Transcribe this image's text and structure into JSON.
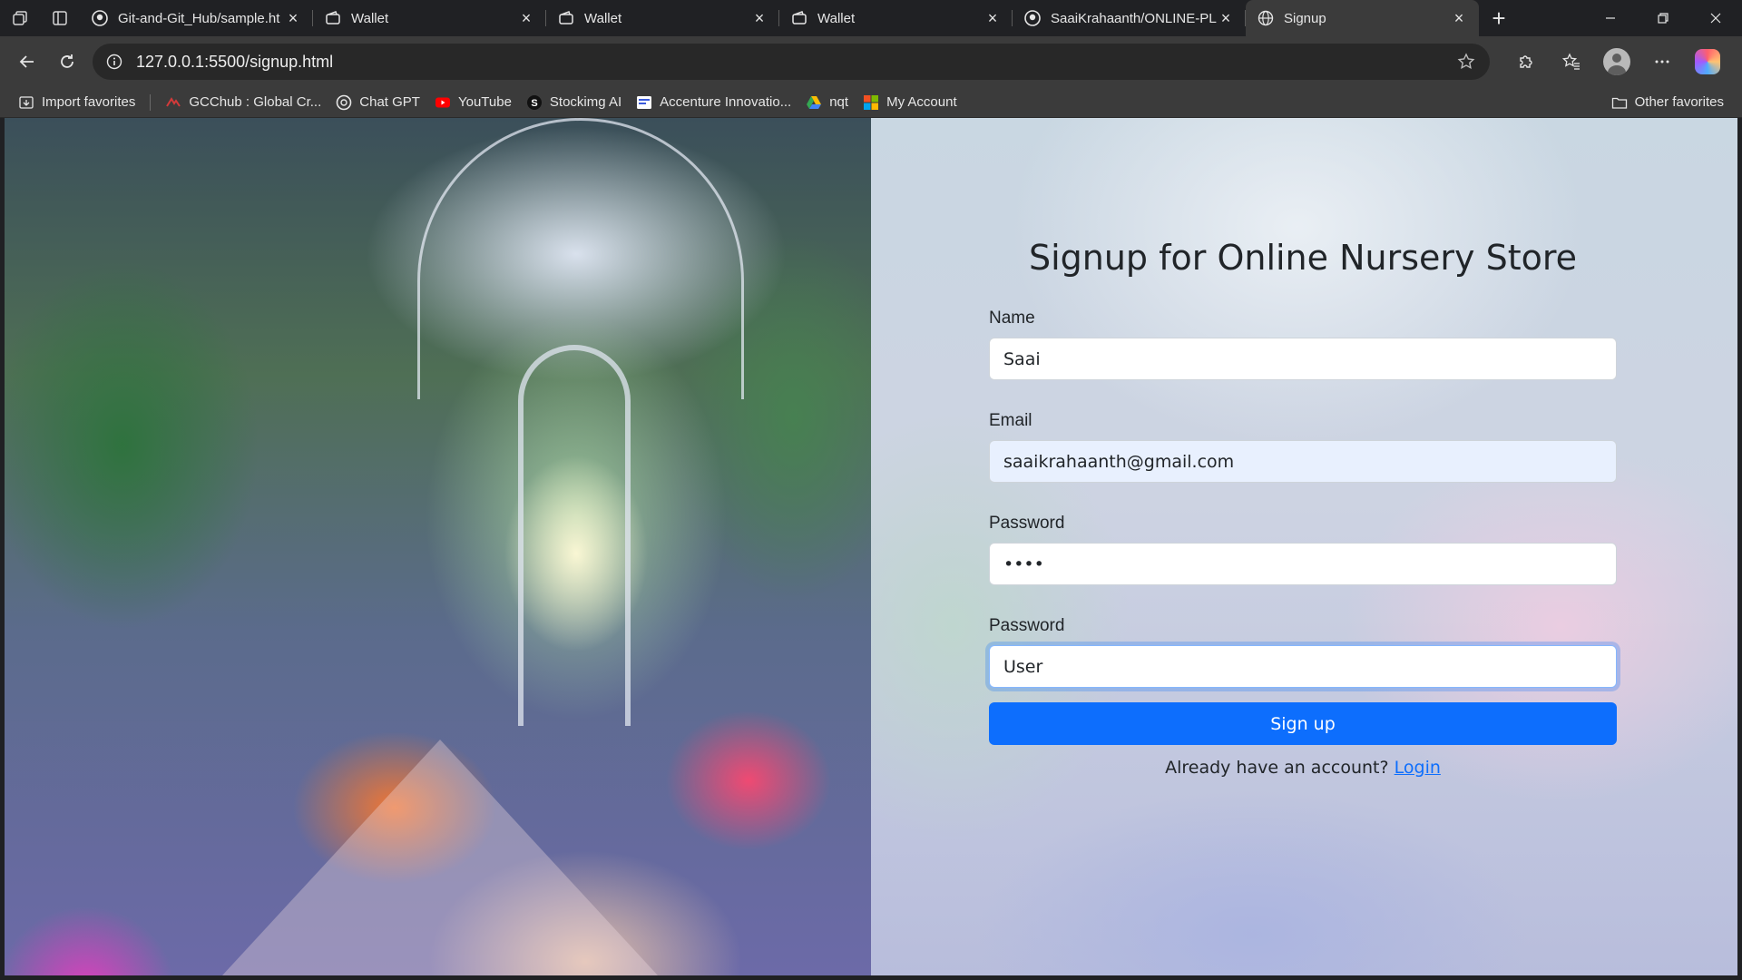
{
  "tabs": [
    {
      "title": "Git-and-Git_Hub/sample.ht",
      "icon": "github-icon"
    },
    {
      "title": "Wallet",
      "icon": "wallet-icon"
    },
    {
      "title": "Wallet",
      "icon": "wallet-icon"
    },
    {
      "title": "Wallet",
      "icon": "wallet-icon"
    },
    {
      "title": "SaaiKrahaanth/ONLINE-PL/",
      "icon": "github-icon"
    },
    {
      "title": "Signup",
      "icon": "globe-icon",
      "active": true
    }
  ],
  "address_bar": {
    "url": "127.0.0.1:5500/signup.html"
  },
  "bookmarks": [
    {
      "label": "Import favorites",
      "icon": "import-icon"
    },
    {
      "label": "GCChub : Global Cr...",
      "icon": "gcc-icon"
    },
    {
      "label": "Chat GPT",
      "icon": "chatgpt-icon"
    },
    {
      "label": "YouTube",
      "icon": "youtube-icon"
    },
    {
      "label": "Stockimg AI",
      "icon": "stockimg-icon"
    },
    {
      "label": "Accenture Innovatio...",
      "icon": "accenture-icon"
    },
    {
      "label": "nqt",
      "icon": "drive-icon"
    },
    {
      "label": "My Account",
      "icon": "microsoft-icon"
    },
    {
      "label": "Other favorites",
      "icon": "folder-icon"
    }
  ],
  "page": {
    "title": "Signup for Online Nursery Store",
    "fields": [
      {
        "label": "Name",
        "value": "Saai"
      },
      {
        "label": "Email",
        "value": "saaikrahaanth@gmail.com"
      },
      {
        "label": "Password",
        "value": "••••"
      },
      {
        "label": "Password",
        "value": "User"
      }
    ],
    "submit_label": "Sign up",
    "login_prompt": "Already have an account?",
    "login_link": "Login"
  },
  "colors": {
    "primary": "#0d6efd",
    "autofill_bg": "#e8f0fe",
    "chrome_dark": "#202124",
    "chrome_toolbar": "#3b3b3b"
  }
}
